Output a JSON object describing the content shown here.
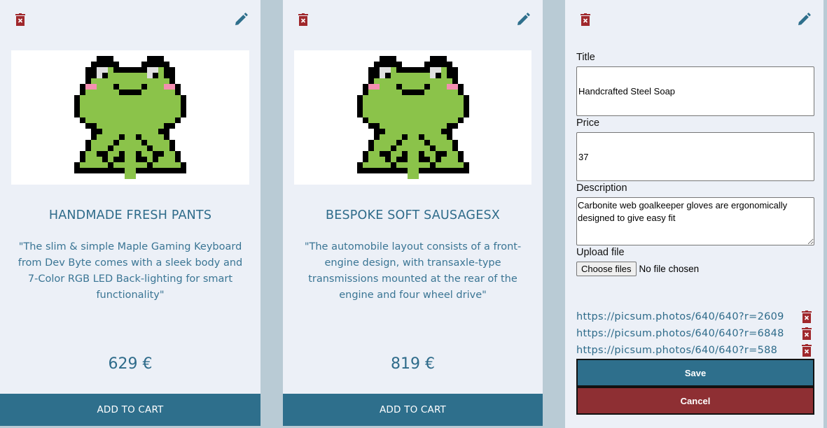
{
  "products": [
    {
      "title": "HANDMADE FRESH PANTS",
      "description": "\"The slim & simple Maple Gaming Keyboard from Dev Byte comes with a sleek body and 7-Color RGB LED Back-lighting for smart functionality\"",
      "price": "629 €",
      "add_to_cart": "ADD TO CART",
      "image_icon": "pixel-frog"
    },
    {
      "title": "BESPOKE SOFT SAUSAGESX",
      "description": "\"The automobile layout consists of a front-engine design, with transaxle-type transmissions mounted at the rear of the engine and four wheel drive\"",
      "price": "819 €",
      "add_to_cart": "ADD TO CART",
      "image_icon": "pixel-frog"
    }
  ],
  "edit_form": {
    "title_label": "Title",
    "title_value": "Handcrafted Steel Soap",
    "price_label": "Price",
    "price_value": "37",
    "description_label": "Description",
    "description_value": "Carbonite web goalkeeper gloves are ergonomically designed to give easy fit",
    "upload_label": "Upload file",
    "choose_files": "Choose files",
    "no_file": "No file chosen",
    "images": [
      "https://picsum.photos/640/640?r=2609",
      "https://picsum.photos/640/640?r=6848",
      "https://picsum.photos/640/640?r=588"
    ],
    "save_label": "Save",
    "cancel_label": "Cancel"
  },
  "icons": {
    "delete": "trash-icon",
    "edit": "pencil-icon"
  },
  "colors": {
    "accent": "#2e6f8c",
    "danger": "#8e2f33",
    "card_bg": "#ecf0f7",
    "page_bg": "#b9cbd5",
    "frog_green": "#8bc34a"
  }
}
